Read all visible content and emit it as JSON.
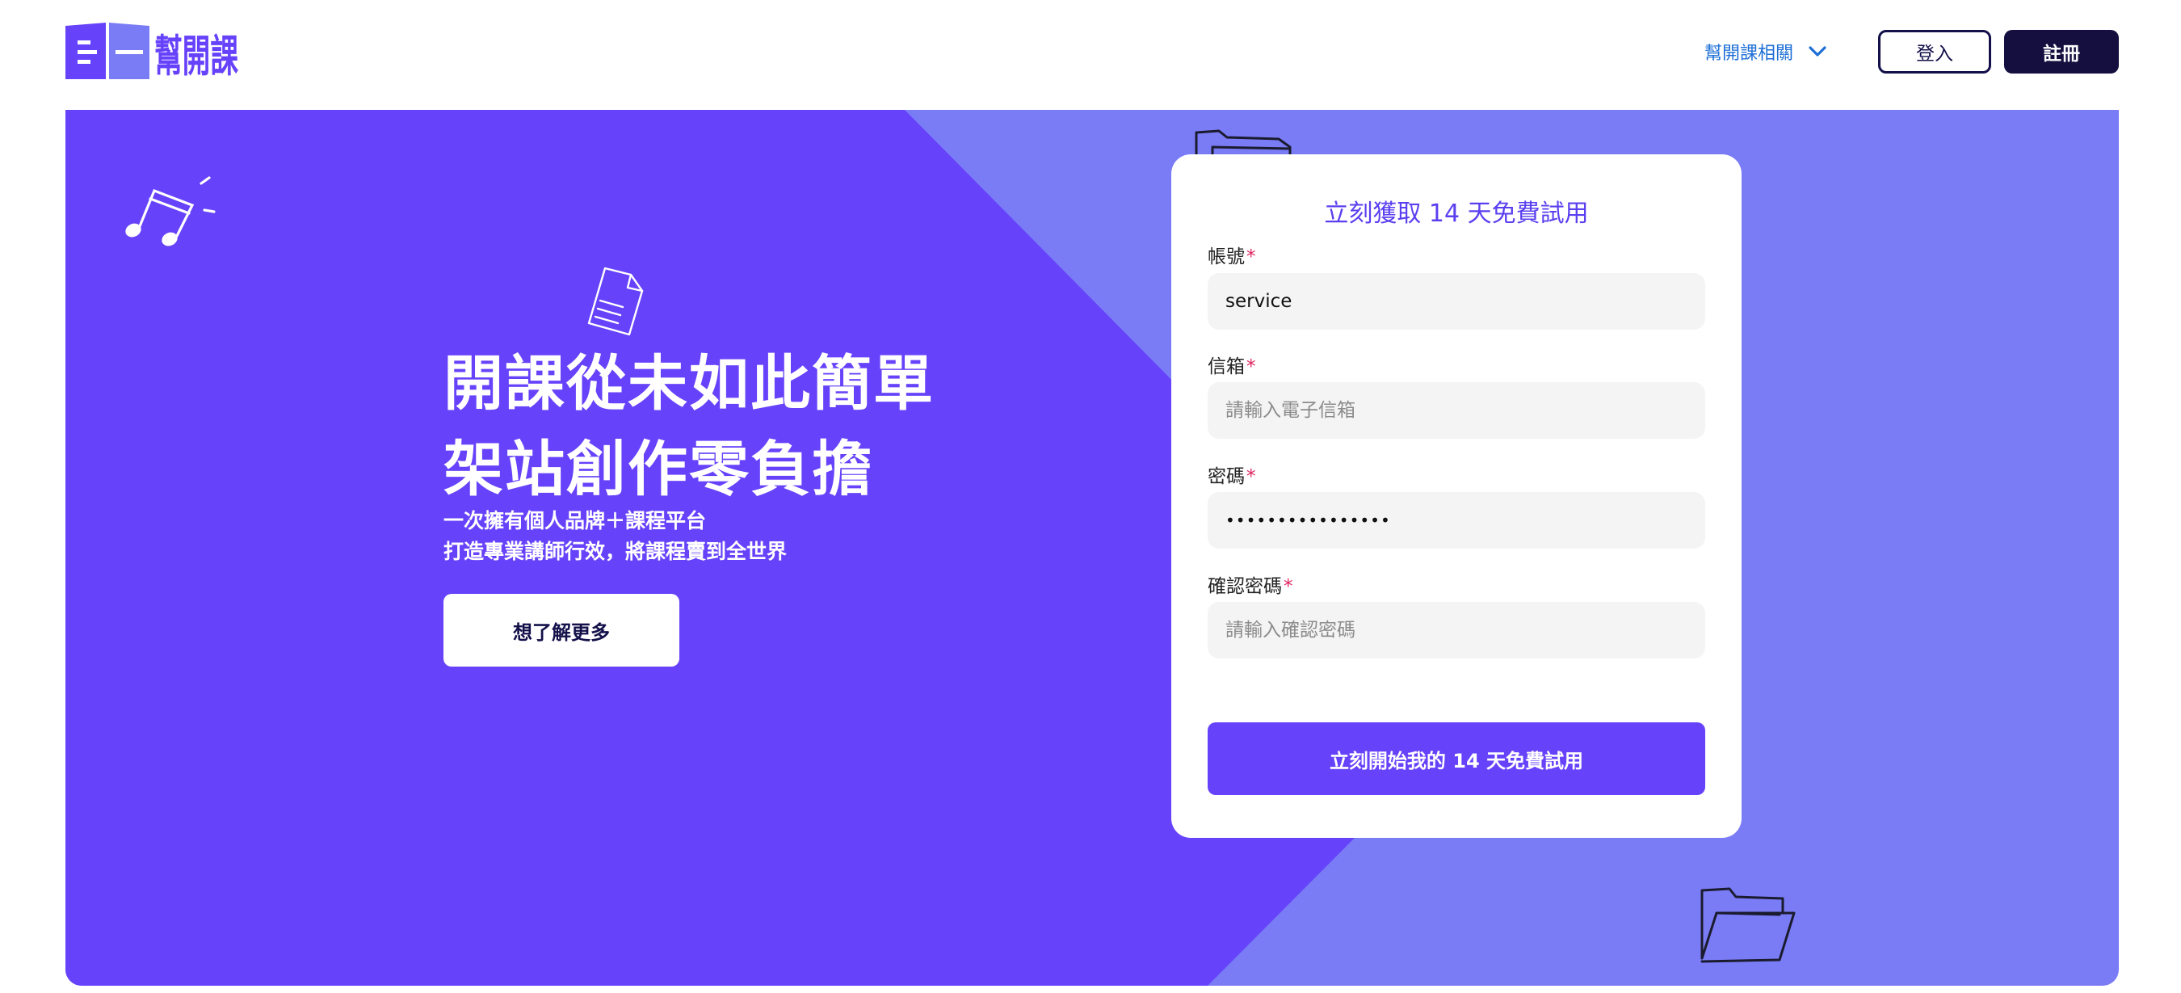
{
  "brand": {
    "name": "幫開課",
    "colors": {
      "primary": "#6742fb",
      "hero_dark": "#6a45fb",
      "hero_light": "#7a7cf6",
      "navy": "#140f3f",
      "link_blue": "#1e6fd6",
      "required_red": "#e0245e"
    }
  },
  "header": {
    "nav_menu_label": "幫開課相關",
    "nav_menu_icon": "chevron-down-icon",
    "login_label": "登入",
    "register_label": "註冊"
  },
  "hero": {
    "title_line1": "開課從未如此簡單",
    "title_line2": "架站創作零負擔",
    "subtitle_line1": "一次擁有個人品牌＋課程平台",
    "subtitle_line2": "打造專業講師行效，將課程賣到全世界",
    "cta_label": "想了解更多",
    "decorations": [
      "music-note-icon",
      "document-icon",
      "folder-icon",
      "folder-icon"
    ]
  },
  "form": {
    "title": "立刻獲取 14 天免費試用",
    "required_mark": "*",
    "fields": {
      "account": {
        "label": "帳號",
        "value": "service",
        "placeholder": ""
      },
      "email": {
        "label": "信箱",
        "value": "",
        "placeholder": "請輸入電子信箱"
      },
      "password": {
        "label": "密碼",
        "value": "Service123456789",
        "placeholder": ""
      },
      "confirm_password": {
        "label": "確認密碼",
        "value": "",
        "placeholder": "請輸入確認密碼"
      }
    },
    "submit_label": "立刻開始我的 14 天免費試用"
  }
}
